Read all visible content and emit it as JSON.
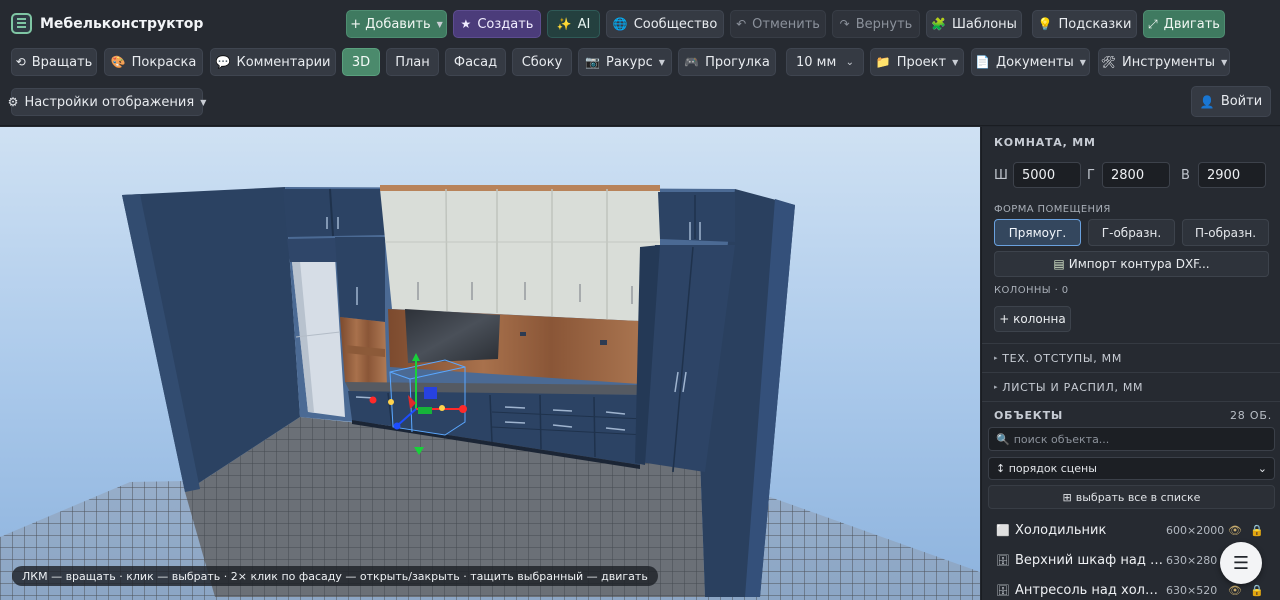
{
  "app": {
    "title": "Мебельконструктор"
  },
  "toolbar": {
    "add": "+ Добавить",
    "create": "Создать",
    "ai": "AI",
    "community": "Сообщество",
    "undo": "Отменить",
    "redo": "Вернуть",
    "templates": "Шаблоны",
    "hints": "Подсказки",
    "move": "Двигать",
    "rotate": "Вращать",
    "paint": "Покраска",
    "comments": "Комментарии",
    "view_3d": "3D",
    "view_plan": "План",
    "view_facade": "Фасад",
    "view_side": "Сбоку",
    "angle": "Ракурс",
    "walk": "Прогулка",
    "step": "10 мм",
    "project": "Проект",
    "documents": "Документы",
    "tools": "Инструменты",
    "display_settings": "Настройки отображения",
    "login": "Войти"
  },
  "viewport": {
    "hint": "ЛКМ — вращать · клик — выбрать · 2× клик по фасаду — открыть/закрыть · тащить выбранный — двигать"
  },
  "panel": {
    "room_title": "КОМНАТА, ММ",
    "width_label": "Ш",
    "width_value": "5000",
    "depth_label": "Г",
    "depth_value": "2800",
    "height_label": "В",
    "height_value": "2900",
    "shape_title": "ФОРМА ПОМЕЩЕНИЯ",
    "shape_rect": "Прямоуг.",
    "shape_l": "Г-образн.",
    "shape_u": "П-образн.",
    "import_dxf": "Импорт контура DXF...",
    "columns_label": "КОЛОННЫ · 0",
    "add_column": "+ колонна",
    "offsets": "ТЕХ. ОТСТУПЫ, ММ",
    "sheets": "ЛИСТЫ И РАСПИЛ, ММ",
    "objects_title": "ОБЪЕКТЫ",
    "objects_count": "28 ОБ.",
    "search_placeholder": "поиск объекта...",
    "sort_value": "порядок сцены",
    "select_all": "выбрать все в списке",
    "objects": [
      {
        "name": "Холодильник",
        "size": "600×2000"
      },
      {
        "name": "Верхний шкаф над холо...",
        "size": "630×280"
      },
      {
        "name": "Антресоль над холоди...",
        "size": "630×520"
      }
    ]
  },
  "colors": {
    "accent_green": "#3f7a60",
    "accent_purple": "#4b3c7a",
    "cabinet_navy": "#2c4364",
    "upper_facade": "#d9ddd8",
    "floor_grid": "#7a7f86"
  }
}
